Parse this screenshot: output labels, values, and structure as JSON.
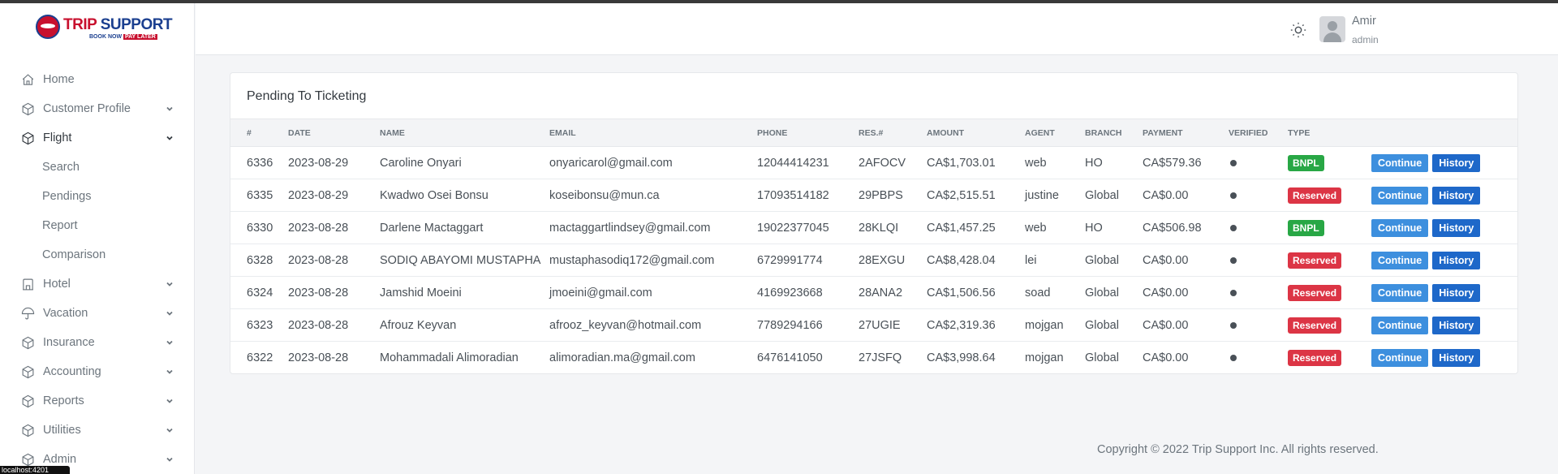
{
  "brand": {
    "name_part1": "TRIP",
    "name_part2": " SUPPORT",
    "tagline_part1": "BOOK NOW ",
    "tagline_part2": "PAY LATER"
  },
  "sidebar": {
    "items": [
      {
        "label": "Home",
        "icon": "home-icon"
      },
      {
        "label": "Customer Profile",
        "icon": "cube-icon"
      },
      {
        "label": "Flight",
        "icon": "cube-icon"
      },
      {
        "label": "Hotel",
        "icon": "building-icon"
      },
      {
        "label": "Vacation",
        "icon": "umbrella-icon"
      },
      {
        "label": "Insurance",
        "icon": "cube-icon"
      },
      {
        "label": "Accounting",
        "icon": "cube-icon"
      },
      {
        "label": "Reports",
        "icon": "cube-icon"
      },
      {
        "label": "Utilities",
        "icon": "cube-icon"
      },
      {
        "label": "Admin",
        "icon": "cube-icon"
      }
    ],
    "flight_sub": [
      "Search",
      "Pendings",
      "Report",
      "Comparison"
    ],
    "tooltip_text": "localhost:4201"
  },
  "header": {
    "theme_icon": "sun-icon",
    "user_name": "Amir",
    "user_role": "admin"
  },
  "card": {
    "title": "Pending To Ticketing",
    "columns": [
      "#",
      "DATE",
      "NAME",
      "EMAIL",
      "PHONE",
      "RES.#",
      "AMOUNT",
      "AGENT",
      "BRANCH",
      "PAYMENT",
      "VERIFIED",
      "TYPE",
      ""
    ],
    "continue_label": "Continue",
    "history_label": "History",
    "rows": [
      {
        "id": "6336",
        "date": "2023-08-29",
        "name": "Caroline Onyari",
        "email": "onyaricarol@gmail.com",
        "phone": "12044414231",
        "res": "2AFOCV",
        "amount": "CA$1,703.01",
        "agent": "web",
        "branch": "HO",
        "payment": "CA$579.36",
        "type": "BNPL"
      },
      {
        "id": "6335",
        "date": "2023-08-29",
        "name": "Kwadwo Osei Bonsu",
        "email": "koseibonsu@mun.ca",
        "phone": "17093514182",
        "res": "29PBPS",
        "amount": "CA$2,515.51",
        "agent": "justine",
        "branch": "Global",
        "payment": "CA$0.00",
        "type": "Reserved"
      },
      {
        "id": "6330",
        "date": "2023-08-28",
        "name": "Darlene Mactaggart",
        "email": "mactaggartlindsey@gmail.com",
        "phone": "19022377045",
        "res": "28KLQI",
        "amount": "CA$1,457.25",
        "agent": "web",
        "branch": "HO",
        "payment": "CA$506.98",
        "type": "BNPL"
      },
      {
        "id": "6328",
        "date": "2023-08-28",
        "name": "SODIQ ABAYOMI MUSTAPHA",
        "email": "mustaphasodiq172@gmail.com",
        "phone": "6729991774",
        "res": "28EXGU",
        "amount": "CA$8,428.04",
        "agent": "lei",
        "branch": "Global",
        "payment": "CA$0.00",
        "type": "Reserved"
      },
      {
        "id": "6324",
        "date": "2023-08-28",
        "name": "Jamshid Moeini",
        "email": "jmoeini@gmail.com",
        "phone": "4169923668",
        "res": "28ANA2",
        "amount": "CA$1,506.56",
        "agent": "soad",
        "branch": "Global",
        "payment": "CA$0.00",
        "type": "Reserved"
      },
      {
        "id": "6323",
        "date": "2023-08-28",
        "name": "Afrouz Keyvan",
        "email": "afrooz_keyvan@hotmail.com",
        "phone": "7789294166",
        "res": "27UGIE",
        "amount": "CA$2,319.36",
        "agent": "mojgan",
        "branch": "Global",
        "payment": "CA$0.00",
        "type": "Reserved"
      },
      {
        "id": "6322",
        "date": "2023-08-28",
        "name": "Mohammadali Alimoradian",
        "email": "alimoradian.ma@gmail.com",
        "phone": "6476141050",
        "res": "27JSFQ",
        "amount": "CA$3,998.64",
        "agent": "mojgan",
        "branch": "Global",
        "payment": "CA$0.00",
        "type": "Reserved"
      }
    ]
  },
  "footer": {
    "copyright": "Copyright © 2022 Trip Support Inc. All rights reserved."
  },
  "colors": {
    "bnpl": "#28a745",
    "reserved": "#dc3545",
    "continue": "#3d8fde",
    "history": "#1e68c9"
  }
}
